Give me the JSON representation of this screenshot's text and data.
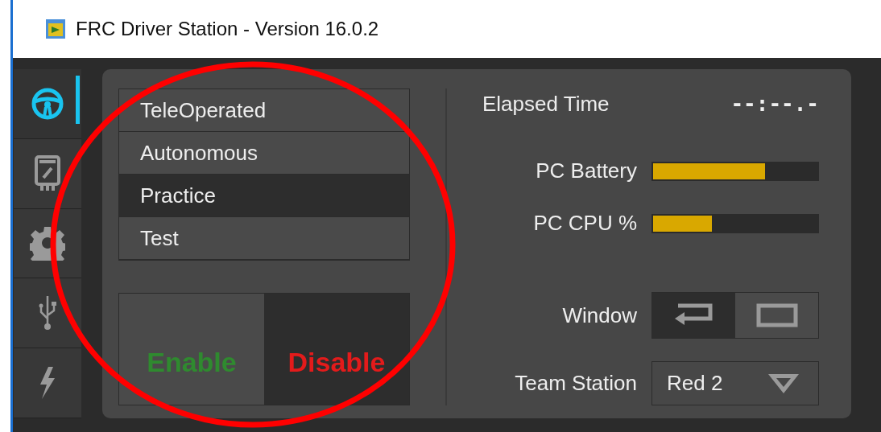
{
  "window": {
    "title": "FRC Driver Station - Version 16.0.2"
  },
  "sidebar": {
    "tabs": [
      {
        "kind": "drive",
        "selected": true
      },
      {
        "kind": "diagnostics",
        "selected": false
      },
      {
        "kind": "setup",
        "selected": false
      },
      {
        "kind": "usb",
        "selected": false
      },
      {
        "kind": "power",
        "selected": false
      }
    ]
  },
  "modes": [
    {
      "label": "TeleOperated",
      "selected": false
    },
    {
      "label": "Autonomous",
      "selected": false
    },
    {
      "label": "Practice",
      "selected": true
    },
    {
      "label": "Test",
      "selected": false
    }
  ],
  "enable_controls": [
    {
      "kind": "enable",
      "label": "Enable",
      "selected": false
    },
    {
      "kind": "disable",
      "label": "Disable",
      "selected": true
    }
  ],
  "elapsed_time": {
    "label": "Elapsed Time",
    "value": "--:--.-"
  },
  "meters": [
    {
      "label": "PC Battery",
      "level": 0.68
    },
    {
      "label": "PC CPU %",
      "level": 0.36
    }
  ],
  "window_mode": {
    "label": "Window",
    "options": [
      {
        "kind": "docked",
        "selected": true
      },
      {
        "kind": "normal",
        "selected": false
      }
    ]
  },
  "team_station": {
    "label": "Team Station",
    "value": "Red 2"
  },
  "annotation": {
    "kind": "circle",
    "color": "#ff0000"
  }
}
